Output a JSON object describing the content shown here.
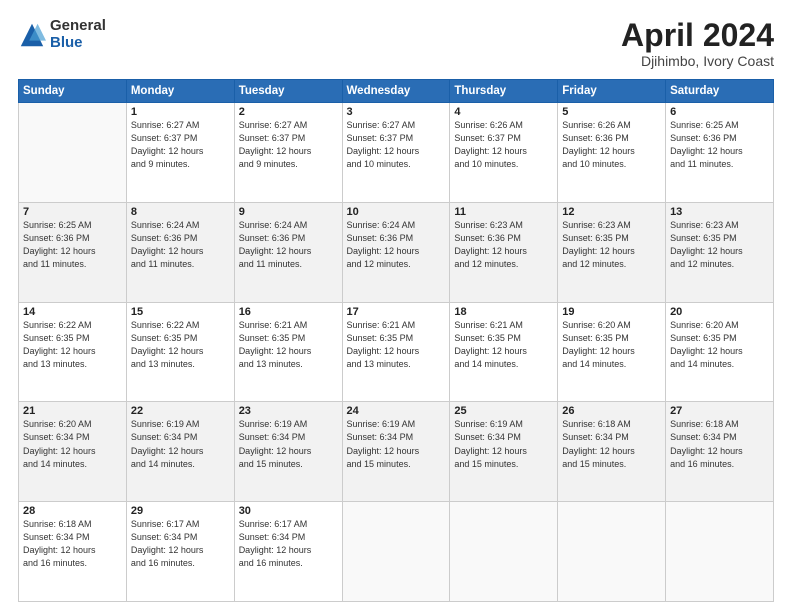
{
  "header": {
    "logo_general": "General",
    "logo_blue": "Blue",
    "title": "April 2024",
    "subtitle": "Djihimbo, Ivory Coast"
  },
  "calendar": {
    "days_of_week": [
      "Sunday",
      "Monday",
      "Tuesday",
      "Wednesday",
      "Thursday",
      "Friday",
      "Saturday"
    ],
    "weeks": [
      [
        {
          "num": "",
          "detail": ""
        },
        {
          "num": "1",
          "detail": "Sunrise: 6:27 AM\nSunset: 6:37 PM\nDaylight: 12 hours\nand 9 minutes."
        },
        {
          "num": "2",
          "detail": "Sunrise: 6:27 AM\nSunset: 6:37 PM\nDaylight: 12 hours\nand 9 minutes."
        },
        {
          "num": "3",
          "detail": "Sunrise: 6:27 AM\nSunset: 6:37 PM\nDaylight: 12 hours\nand 10 minutes."
        },
        {
          "num": "4",
          "detail": "Sunrise: 6:26 AM\nSunset: 6:37 PM\nDaylight: 12 hours\nand 10 minutes."
        },
        {
          "num": "5",
          "detail": "Sunrise: 6:26 AM\nSunset: 6:36 PM\nDaylight: 12 hours\nand 10 minutes."
        },
        {
          "num": "6",
          "detail": "Sunrise: 6:25 AM\nSunset: 6:36 PM\nDaylight: 12 hours\nand 11 minutes."
        }
      ],
      [
        {
          "num": "7",
          "detail": "Sunrise: 6:25 AM\nSunset: 6:36 PM\nDaylight: 12 hours\nand 11 minutes."
        },
        {
          "num": "8",
          "detail": "Sunrise: 6:24 AM\nSunset: 6:36 PM\nDaylight: 12 hours\nand 11 minutes."
        },
        {
          "num": "9",
          "detail": "Sunrise: 6:24 AM\nSunset: 6:36 PM\nDaylight: 12 hours\nand 11 minutes."
        },
        {
          "num": "10",
          "detail": "Sunrise: 6:24 AM\nSunset: 6:36 PM\nDaylight: 12 hours\nand 12 minutes."
        },
        {
          "num": "11",
          "detail": "Sunrise: 6:23 AM\nSunset: 6:36 PM\nDaylight: 12 hours\nand 12 minutes."
        },
        {
          "num": "12",
          "detail": "Sunrise: 6:23 AM\nSunset: 6:35 PM\nDaylight: 12 hours\nand 12 minutes."
        },
        {
          "num": "13",
          "detail": "Sunrise: 6:23 AM\nSunset: 6:35 PM\nDaylight: 12 hours\nand 12 minutes."
        }
      ],
      [
        {
          "num": "14",
          "detail": "Sunrise: 6:22 AM\nSunset: 6:35 PM\nDaylight: 12 hours\nand 13 minutes."
        },
        {
          "num": "15",
          "detail": "Sunrise: 6:22 AM\nSunset: 6:35 PM\nDaylight: 12 hours\nand 13 minutes."
        },
        {
          "num": "16",
          "detail": "Sunrise: 6:21 AM\nSunset: 6:35 PM\nDaylight: 12 hours\nand 13 minutes."
        },
        {
          "num": "17",
          "detail": "Sunrise: 6:21 AM\nSunset: 6:35 PM\nDaylight: 12 hours\nand 13 minutes."
        },
        {
          "num": "18",
          "detail": "Sunrise: 6:21 AM\nSunset: 6:35 PM\nDaylight: 12 hours\nand 14 minutes."
        },
        {
          "num": "19",
          "detail": "Sunrise: 6:20 AM\nSunset: 6:35 PM\nDaylight: 12 hours\nand 14 minutes."
        },
        {
          "num": "20",
          "detail": "Sunrise: 6:20 AM\nSunset: 6:35 PM\nDaylight: 12 hours\nand 14 minutes."
        }
      ],
      [
        {
          "num": "21",
          "detail": "Sunrise: 6:20 AM\nSunset: 6:34 PM\nDaylight: 12 hours\nand 14 minutes."
        },
        {
          "num": "22",
          "detail": "Sunrise: 6:19 AM\nSunset: 6:34 PM\nDaylight: 12 hours\nand 14 minutes."
        },
        {
          "num": "23",
          "detail": "Sunrise: 6:19 AM\nSunset: 6:34 PM\nDaylight: 12 hours\nand 15 minutes."
        },
        {
          "num": "24",
          "detail": "Sunrise: 6:19 AM\nSunset: 6:34 PM\nDaylight: 12 hours\nand 15 minutes."
        },
        {
          "num": "25",
          "detail": "Sunrise: 6:19 AM\nSunset: 6:34 PM\nDaylight: 12 hours\nand 15 minutes."
        },
        {
          "num": "26",
          "detail": "Sunrise: 6:18 AM\nSunset: 6:34 PM\nDaylight: 12 hours\nand 15 minutes."
        },
        {
          "num": "27",
          "detail": "Sunrise: 6:18 AM\nSunset: 6:34 PM\nDaylight: 12 hours\nand 16 minutes."
        }
      ],
      [
        {
          "num": "28",
          "detail": "Sunrise: 6:18 AM\nSunset: 6:34 PM\nDaylight: 12 hours\nand 16 minutes."
        },
        {
          "num": "29",
          "detail": "Sunrise: 6:17 AM\nSunset: 6:34 PM\nDaylight: 12 hours\nand 16 minutes."
        },
        {
          "num": "30",
          "detail": "Sunrise: 6:17 AM\nSunset: 6:34 PM\nDaylight: 12 hours\nand 16 minutes."
        },
        {
          "num": "",
          "detail": ""
        },
        {
          "num": "",
          "detail": ""
        },
        {
          "num": "",
          "detail": ""
        },
        {
          "num": "",
          "detail": ""
        }
      ]
    ]
  }
}
